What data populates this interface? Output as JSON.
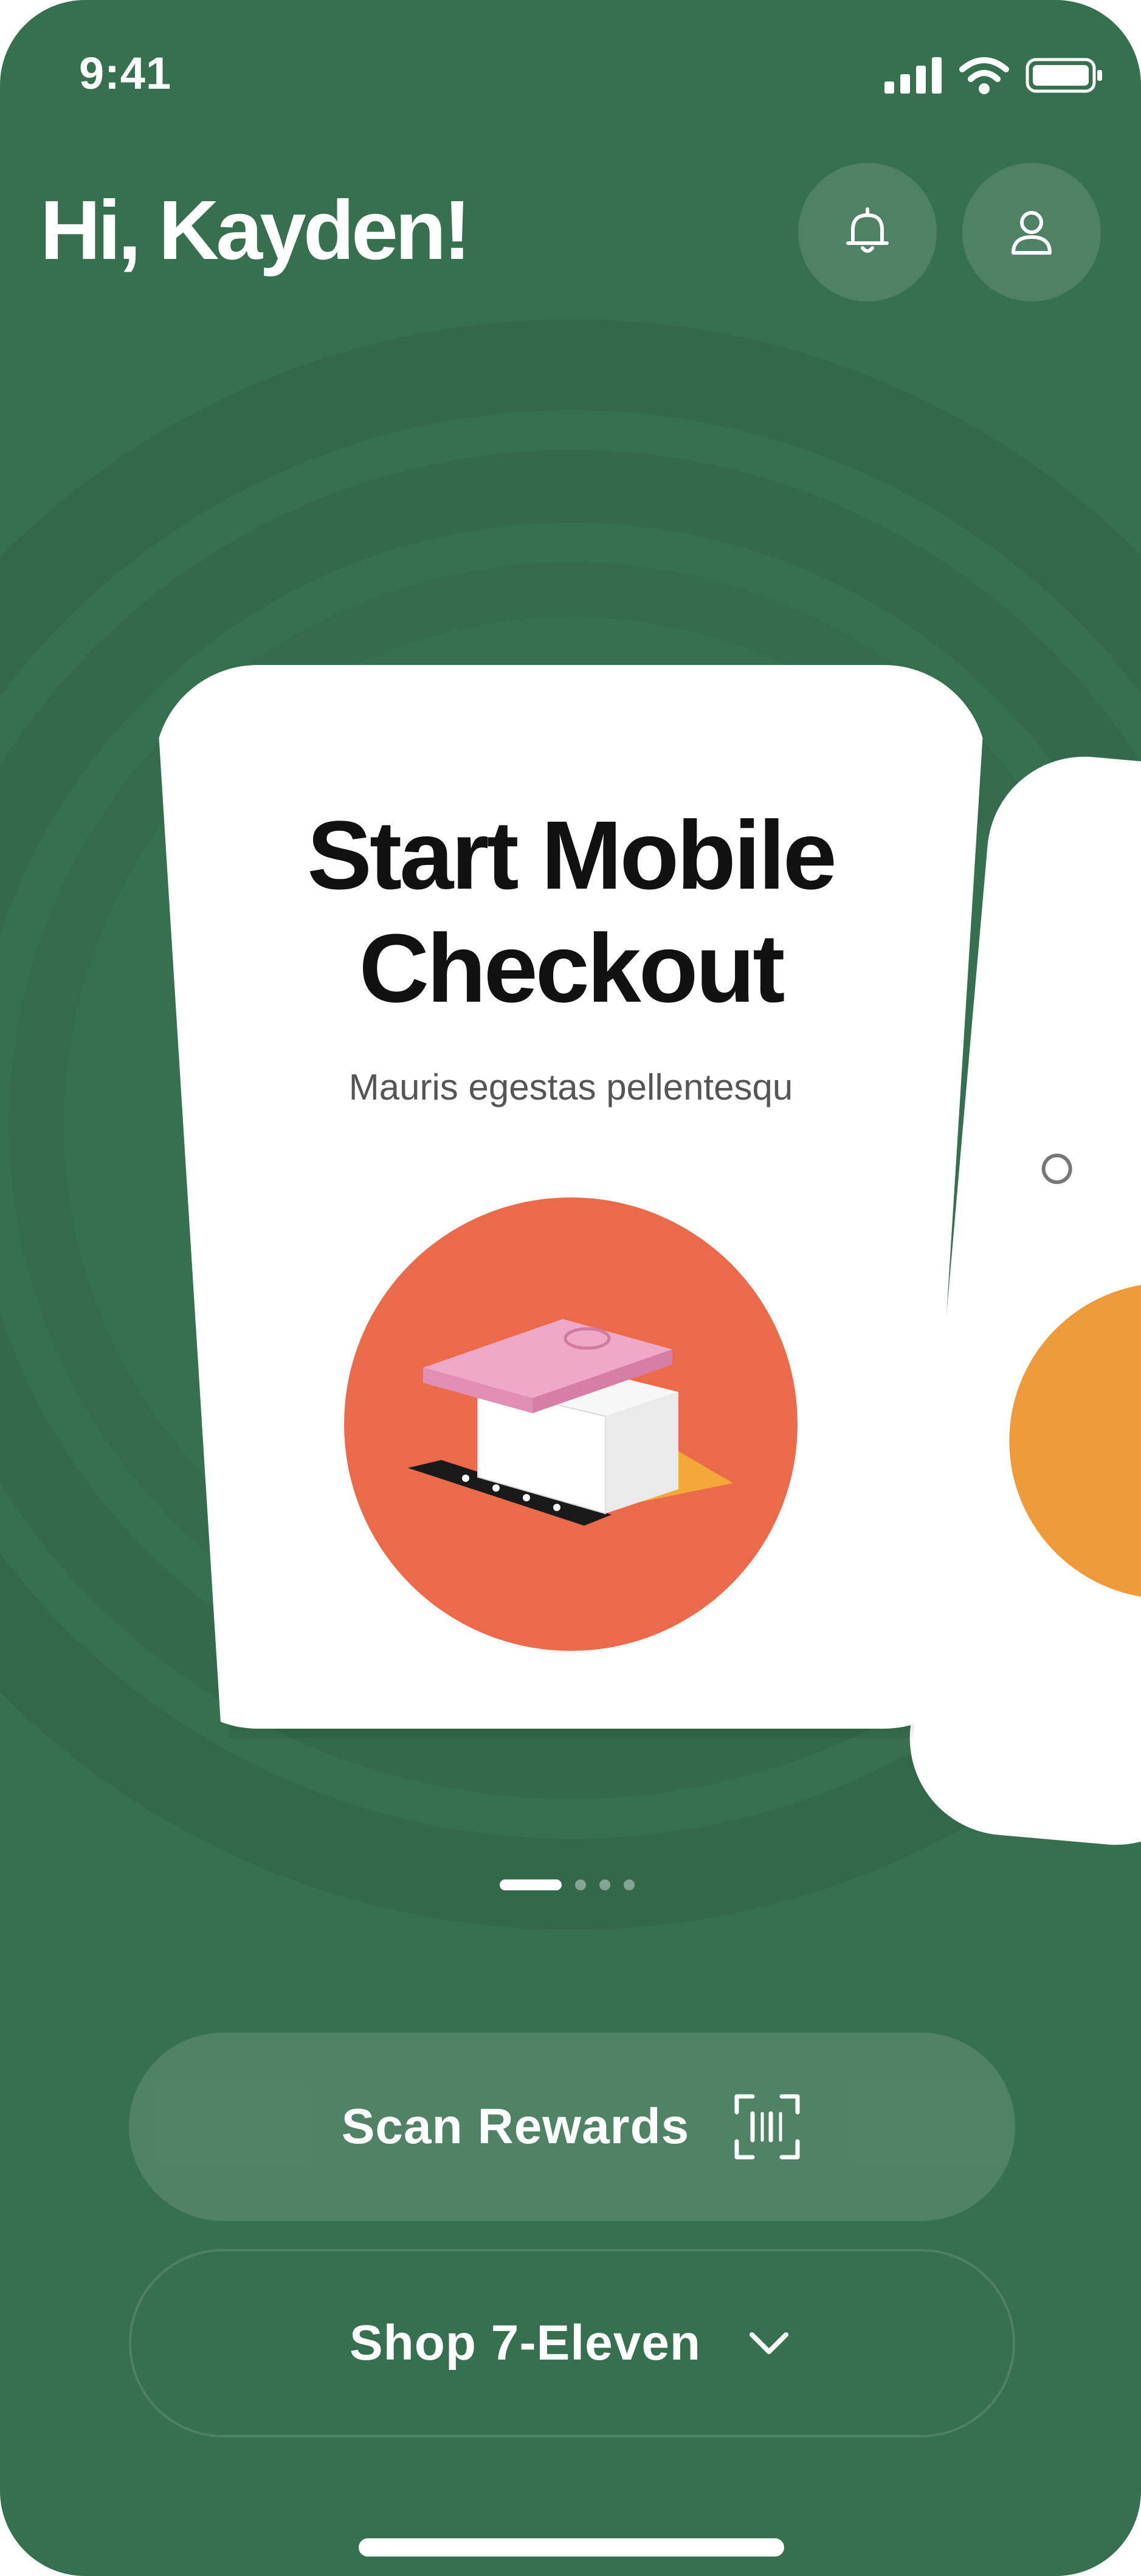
{
  "status_bar": {
    "time": "9:41"
  },
  "header": {
    "greeting": "Hi, Kayden!"
  },
  "carousel": {
    "active_index": 0,
    "page_count": 4,
    "cards": [
      {
        "title_line1": "Start Mobile",
        "title_line2": "Checkout",
        "subtitle": "Mauris egestas pellentesqu"
      }
    ]
  },
  "actions": {
    "scan_label": "Scan Rewards",
    "shop_label": "Shop 7-Eleven"
  },
  "icons": {
    "notifications": "bell-icon",
    "profile": "user-icon",
    "scan": "barcode-scan-icon",
    "shop": "chevron-down-icon"
  },
  "colors": {
    "background": "#37704f",
    "card": "#ffffff",
    "illustration_circle": "#ea6a4a",
    "accent_orange": "#ec9a3a"
  }
}
